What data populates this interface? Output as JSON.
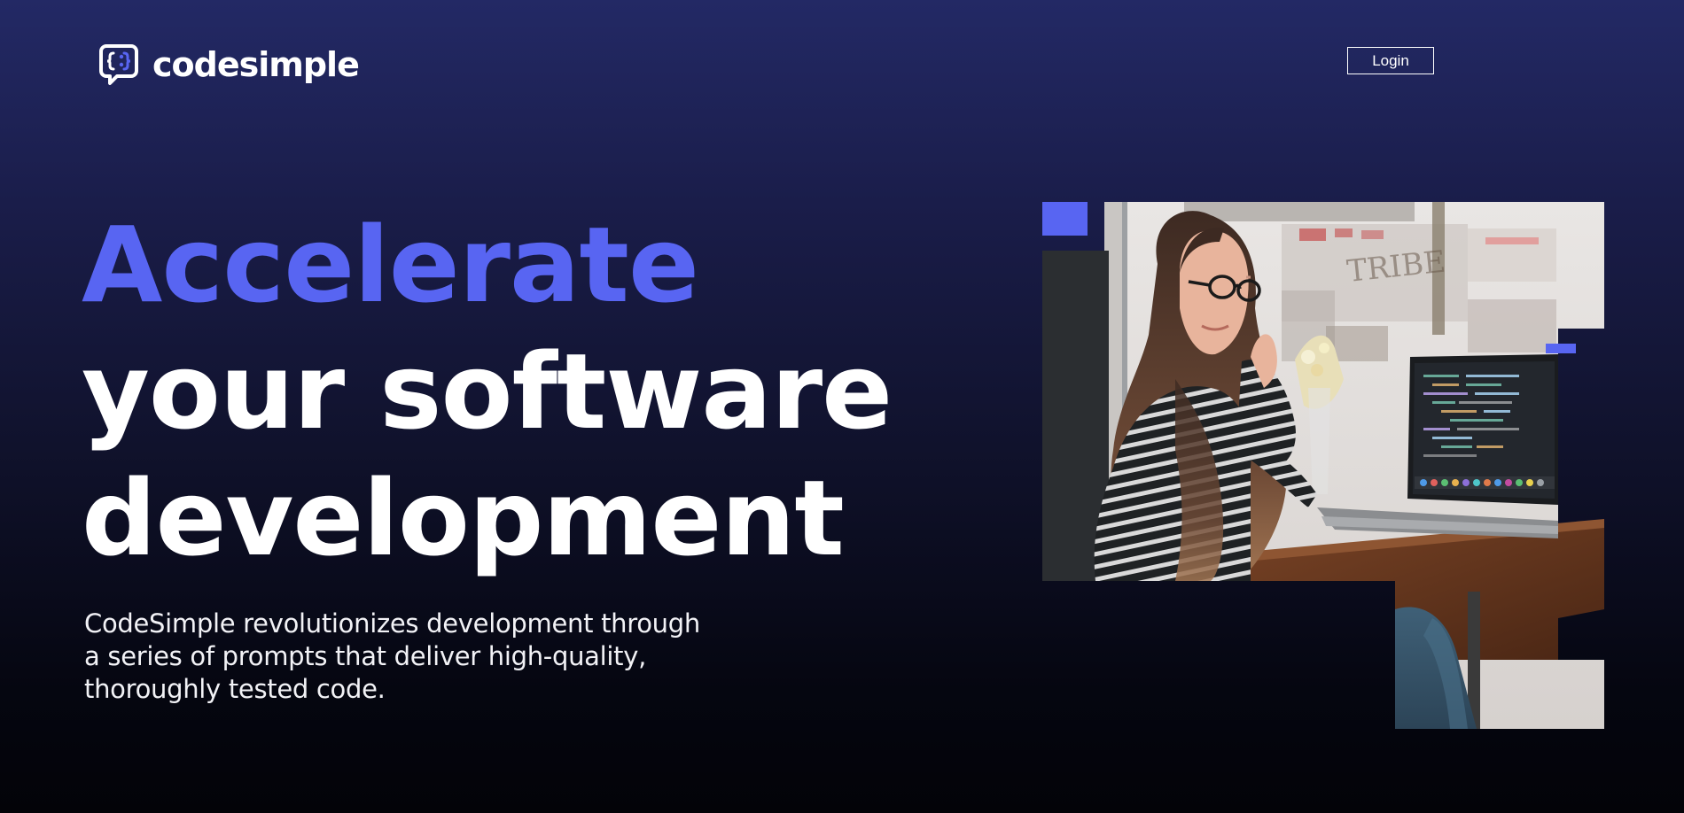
{
  "brand": {
    "name": "codesimple",
    "accent_color": "#5865f2",
    "icon": "code-chat-bubble-icon"
  },
  "nav": {
    "login_label": "Login"
  },
  "hero": {
    "headline_line1": "Accelerate",
    "headline_line2": "your software",
    "headline_line3": "development",
    "description": "CodeSimple revolutionizes development through a series of prompts that deliver high-quality, thoroughly tested code."
  },
  "image": {
    "subject": "woman-with-laptop-photo"
  }
}
